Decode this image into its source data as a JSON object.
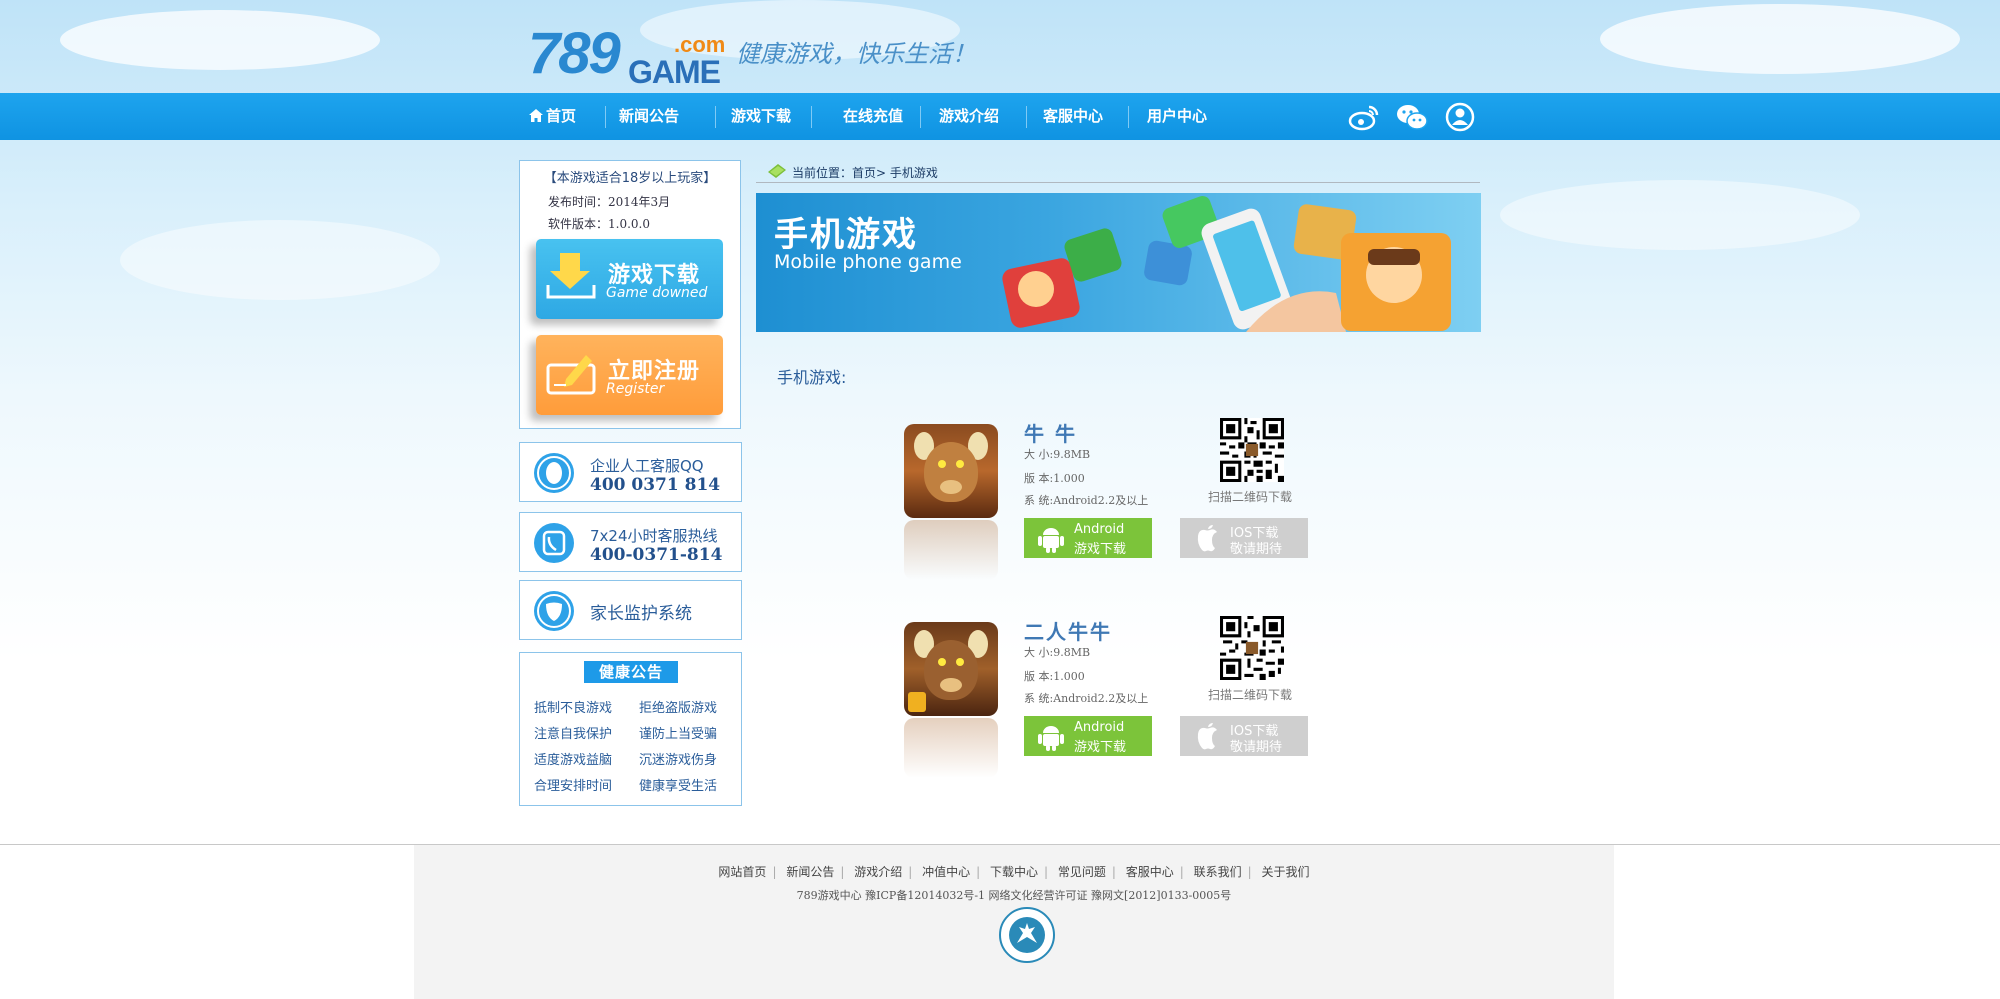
{
  "header": {
    "logo_number": "789",
    "logo_game": "GAME",
    "logo_com": ".com",
    "slogan": "健康游戏，快乐生活！"
  },
  "nav": {
    "items": [
      "首页",
      "新闻公告",
      "游戏下载",
      "在线充值",
      "游戏介绍",
      "客服中心",
      "用户中心"
    ],
    "icons": [
      "weibo-icon",
      "wechat-icon",
      "user-icon"
    ]
  },
  "sidebar": {
    "notice": "【本游戏适合18岁以上玩家】",
    "release_date": "发布时间：2014年3月",
    "version": "软件版本：1.0.0.0",
    "download_button": {
      "cn": "游戏下载",
      "en": "Game downed"
    },
    "register_button": {
      "cn": "立即注册",
      "en": "Register"
    },
    "qq_service": {
      "label": "企业人工客服QQ",
      "number": "400 0371 814"
    },
    "hotline": {
      "label": "7x24小时客服热线",
      "number": "400-0371-814"
    },
    "parent_control": "家长监护系统",
    "health": {
      "title": "健康公告",
      "items": [
        "抵制不良游戏",
        "拒绝盗版游戏",
        "注意自我保护",
        "谨防上当受骗",
        "适度游戏益脑",
        "沉迷游戏伤身",
        "合理安排时间",
        "健康享受生活"
      ]
    }
  },
  "main": {
    "breadcrumb": "当前位置：首页> 手机游戏",
    "banner": {
      "cn": "手机游戏",
      "en": "Mobile phone game"
    },
    "section_title": "手机游戏:",
    "games": [
      {
        "name": "牛 牛",
        "size": "大 小:9.8MB",
        "version": "版 本:1.000",
        "system": "系 统:Android2.2及以上",
        "qr_label": "扫描二维码下载",
        "android_line1": "Android",
        "android_line2": "游戏下载",
        "ios_line1": "IOS下载",
        "ios_line2": "敬请期待"
      },
      {
        "name": "二人牛牛",
        "size": "大 小:9.8MB",
        "version": "版 本:1.000",
        "system": "系 统:Android2.2及以上",
        "qr_label": "扫描二维码下载",
        "android_line1": "Android",
        "android_line2": "游戏下载",
        "ios_line1": "IOS下载",
        "ios_line2": "敬请期待"
      }
    ]
  },
  "footer": {
    "links": [
      "网站首页",
      "新闻公告",
      "游戏介绍",
      "冲值中心",
      "下载中心",
      "常见问题",
      "客服中心",
      "联系我们",
      "关于我们"
    ],
    "icp": "789游戏中心 豫ICP备12014032号-1 网络文化经营许可证 豫网文[2012]0133-0005号"
  },
  "colors": {
    "nav_blue": "#1ea4ee",
    "download_button": "#3cb8ec",
    "register_button": "#ffa64a",
    "android_green": "#7cc43a",
    "ios_gray": "#cfcfcf"
  }
}
